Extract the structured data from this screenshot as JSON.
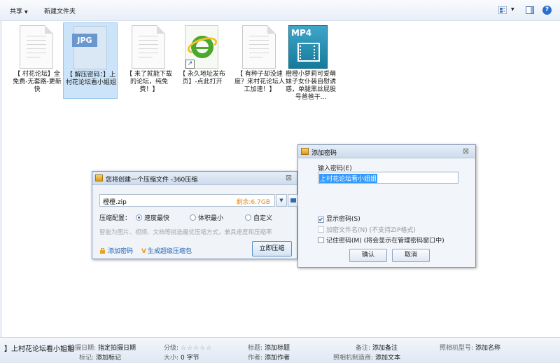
{
  "toolbar": {
    "share_label": "共享",
    "new_folder_label": "新建文件夹",
    "icons": [
      "view-icon",
      "preview-pane-icon",
      "help-icon"
    ],
    "help_glyph": "?"
  },
  "files": [
    {
      "name": "【 村花论坛】全免费-无套路-更新快",
      "icon": "document-icon"
    },
    {
      "name": "【 解压密码：】上村花论坛看小姐姐",
      "icon": "jpg-icon",
      "tag": "JPG",
      "selected": true
    },
    {
      "name": "【 来了就能下载的论坛，纯免费！】",
      "icon": "document-icon"
    },
    {
      "name": "【 永久地址发布页】-点此打开",
      "icon": "ie-shortcut-icon"
    },
    {
      "name": "【 有种子却没速度？来村花论坛人工加速！】",
      "icon": "document-icon"
    },
    {
      "name": "橙橙小萝莉可爱萌妹子女仆装自慰诱惑，单腿黑丝屁股号爸爸干...",
      "icon": "mp4-icon",
      "tag": "MP4"
    }
  ],
  "compress_dialog": {
    "title": "您将创建一个压缩文件 -360压缩",
    "filename": "橙橙.zip",
    "free_space": "剩余:6.7GB",
    "config_label": "压缩配置：",
    "options": [
      {
        "label": "速度最快",
        "selected": true
      },
      {
        "label": "体积最小",
        "selected": false
      },
      {
        "label": "自定义",
        "selected": false
      }
    ],
    "hint": "智能为图片、视频、文档等挑选最优压缩方式，兼具速度和压缩率",
    "add_password_label": "添加密码",
    "super_compress_label": "生成超级压缩包",
    "compress_now_label": "立即压缩"
  },
  "password_dialog": {
    "title": "添加密码",
    "input_label": "输入密码(E)",
    "password_value": "上村花论坛看小姐姐",
    "show_password_label": "显示密码(S)",
    "show_password_checked": true,
    "encrypt_filename_label": "加密文件名(N) (不支持ZIP格式)",
    "encrypt_filename_checked": false,
    "remember_label": "记住密码(M) (将会显示在管理密码窗口中)",
    "remember_checked": false,
    "ok_label": "确认",
    "cancel_label": "取消"
  },
  "statusbar": {
    "title": "】上村花论坛看小姐姐",
    "date_taken_key": "拍摄日期:",
    "date_taken_val": "指定拍摄日期",
    "tags_key": "标记:",
    "tags_val": "添加标记",
    "rating_key": "分级:",
    "rating_stars": "☆☆☆☆☆",
    "size_key": "大小:",
    "size_val": "0 字节",
    "heading_key": "标题:",
    "heading_val": "添加标题",
    "author_key": "作者:",
    "author_val": "添加作者",
    "comment_key": "备注:",
    "comment_val": "添加备注",
    "maker_key": "照相机制造商:",
    "maker_val": "添加文本",
    "model_key": "照相机型号:",
    "model_val": "添加名称"
  }
}
